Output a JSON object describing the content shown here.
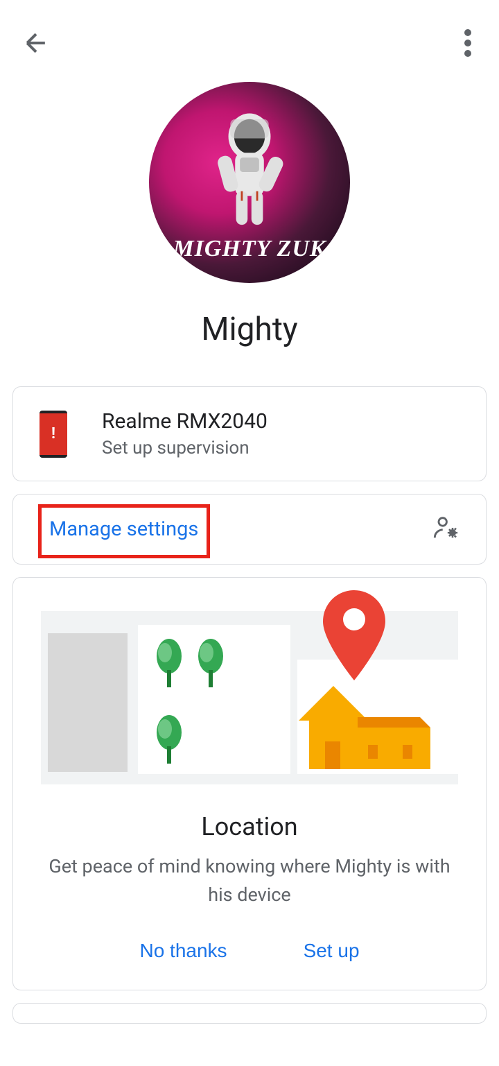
{
  "profile": {
    "name": "Mighty",
    "avatar_text": "MIGHTY ZUK"
  },
  "device": {
    "name": "Realme RMX2040",
    "subtitle": "Set up supervision",
    "icon_symbol": "!"
  },
  "manage": {
    "label": "Manage settings"
  },
  "location_card": {
    "title": "Location",
    "description": "Get peace of mind knowing where Mighty is with his device",
    "no_thanks_label": "No thanks",
    "setup_label": "Set up"
  }
}
